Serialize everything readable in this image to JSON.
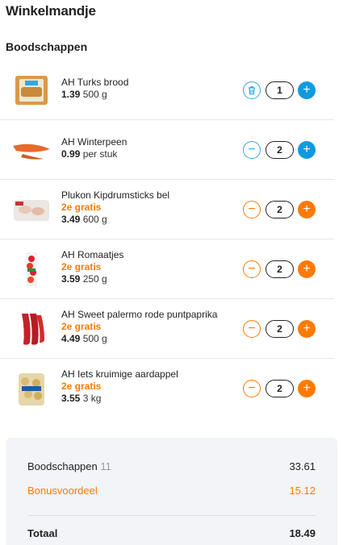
{
  "page": {
    "title": "Winkelmandje"
  },
  "section": {
    "title": "Boodschappen"
  },
  "items": [
    {
      "name": "AH Turks brood",
      "promo": "",
      "price": "1.39",
      "unit": "500 g",
      "quantity": "1",
      "remove_icon": "trash-icon",
      "theme": "blue"
    },
    {
      "name": "AH Winterpeen",
      "promo": "",
      "price": "0.99",
      "unit": "per stuk",
      "quantity": "2",
      "remove_icon": "minus-icon",
      "theme": "blue"
    },
    {
      "name": "Plukon Kipdrumsticks bel",
      "promo": "2e gratis",
      "price": "3.49",
      "unit": "600 g",
      "quantity": "2",
      "remove_icon": "minus-icon",
      "theme": "orange"
    },
    {
      "name": "AH Romaatjes",
      "promo": "2e gratis",
      "price": "3.59",
      "unit": "250 g",
      "quantity": "2",
      "remove_icon": "minus-icon",
      "theme": "orange"
    },
    {
      "name": "AH Sweet palermo rode puntpaprika",
      "promo": "2e gratis",
      "price": "4.49",
      "unit": "500 g",
      "quantity": "2",
      "remove_icon": "minus-icon",
      "theme": "orange"
    },
    {
      "name": "AH Iets kruimige aardappel",
      "promo": "2e gratis",
      "price": "3.55",
      "unit": "3 kg",
      "quantity": "2",
      "remove_icon": "minus-icon",
      "theme": "orange"
    }
  ],
  "summary": {
    "subtotal_label": "Boodschappen",
    "item_count": "11",
    "subtotal_value": "33.61",
    "bonus_label": "Bonusvoordeel",
    "bonus_value": "15.12",
    "total_label": "Totaal",
    "total_value": "18.49"
  },
  "colors": {
    "accent_blue": "#0f9ae0",
    "accent_orange": "#ff7a00",
    "summary_bg": "#f2f4f7"
  }
}
